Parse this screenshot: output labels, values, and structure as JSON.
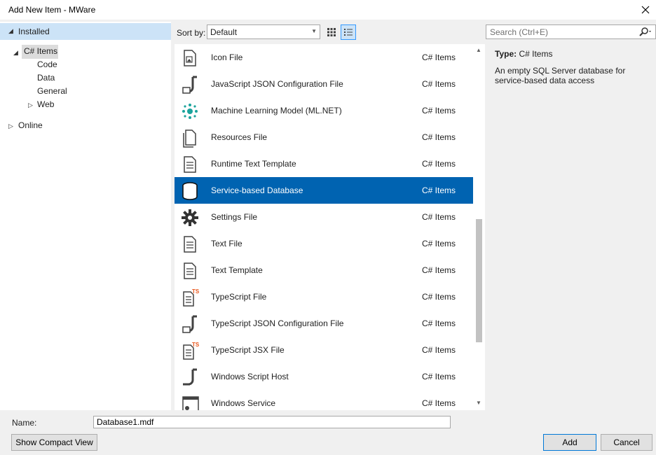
{
  "window": {
    "title": "Add New Item - MWare"
  },
  "tree": {
    "installed": "Installed",
    "csharp_items": "C# Items",
    "code": "Code",
    "data": "Data",
    "general": "General",
    "web": "Web",
    "online": "Online"
  },
  "toolbar": {
    "sort_by_label": "Sort by:",
    "sort_value": "Default",
    "search_placeholder": "Search (Ctrl+E)"
  },
  "items": [
    {
      "name": "Icon File",
      "category": "C# Items",
      "icon": "icon-file-icon"
    },
    {
      "name": "JavaScript JSON Configuration File",
      "category": "C# Items",
      "icon": "json-config-icon"
    },
    {
      "name": "Machine Learning Model (ML.NET)",
      "category": "C# Items",
      "icon": "ml-model-icon"
    },
    {
      "name": "Resources File",
      "category": "C# Items",
      "icon": "resources-file-icon"
    },
    {
      "name": "Runtime Text Template",
      "category": "C# Items",
      "icon": "text-template-icon"
    },
    {
      "name": "Service-based Database",
      "category": "C# Items",
      "icon": "database-icon",
      "selected": true
    },
    {
      "name": "Settings File",
      "category": "C# Items",
      "icon": "gear-icon"
    },
    {
      "name": "Text File",
      "category": "C# Items",
      "icon": "text-file-icon"
    },
    {
      "name": "Text Template",
      "category": "C# Items",
      "icon": "text-template-icon"
    },
    {
      "name": "TypeScript File",
      "category": "C# Items",
      "icon": "typescript-file-icon"
    },
    {
      "name": "TypeScript JSON Configuration File",
      "category": "C# Items",
      "icon": "json-config-icon"
    },
    {
      "name": "TypeScript JSX File",
      "category": "C# Items",
      "icon": "typescript-file-icon"
    },
    {
      "name": "Windows Script Host",
      "category": "C# Items",
      "icon": "script-host-icon"
    },
    {
      "name": "Windows Service",
      "category": "C# Items",
      "icon": "windows-service-icon"
    }
  ],
  "details": {
    "type_label": "Type:",
    "type_value": "C# Items",
    "description": "An empty SQL Server database for service-based data access"
  },
  "footer": {
    "name_label": "Name:",
    "name_value": "Database1.mdf",
    "compact_view_label": "Show Compact View",
    "add_label": "Add",
    "cancel_label": "Cancel"
  },
  "colors": {
    "selection": "#0063b1",
    "tree_selection": "#cce3f7",
    "ml_icon": "#1ba39c",
    "typescript_badge": "#e8581e"
  }
}
